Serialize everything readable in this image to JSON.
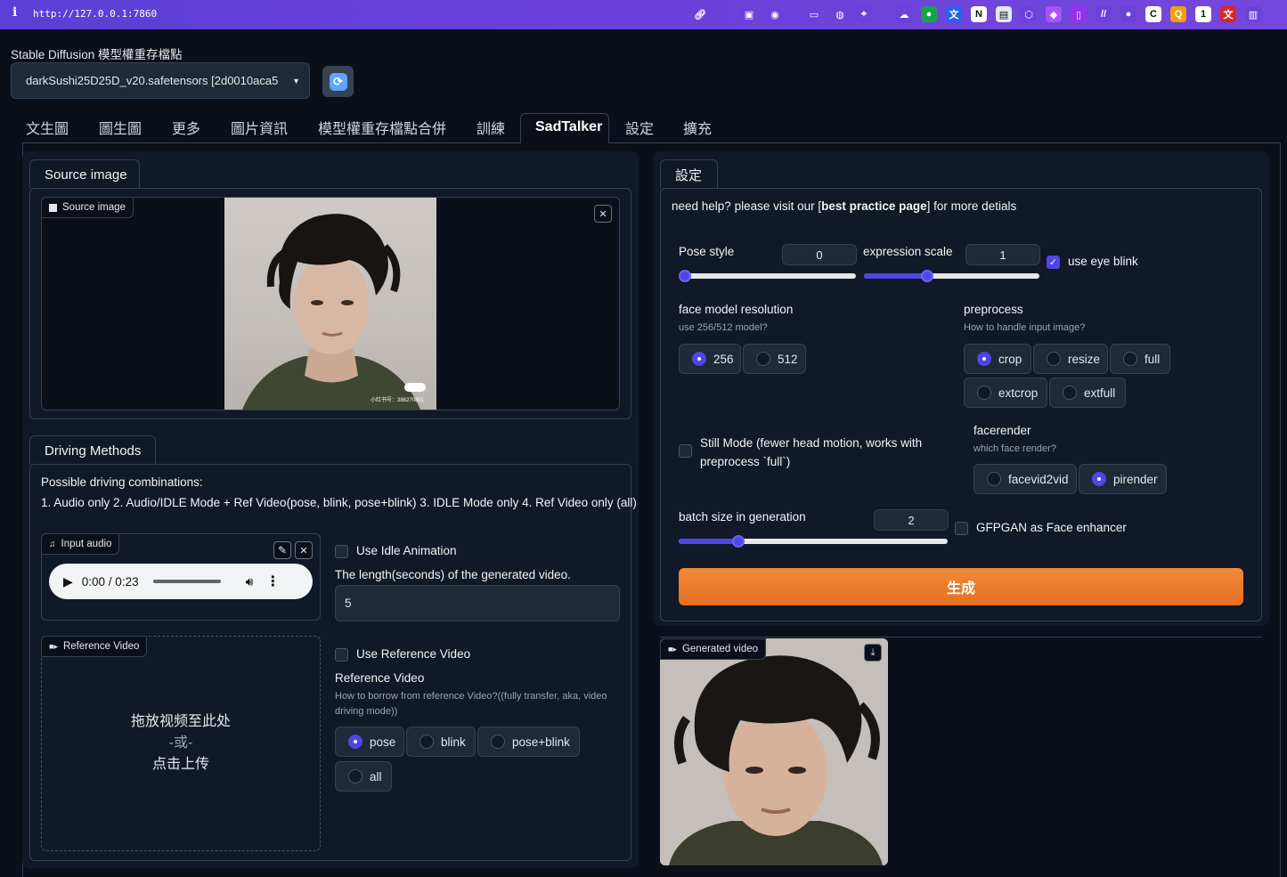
{
  "browser": {
    "info_icon": "i",
    "url": "http://127.0.0.1:7860"
  },
  "extensions": [
    "link-icon",
    "screenshot-icon",
    "camera-icon",
    "terminal-icon",
    "globe-icon",
    "target-icon",
    "cloud-icon",
    "chat-icon",
    "translate-icon",
    "N",
    "card-icon",
    "shield-icon",
    "diamond-icon",
    "bookmark-icon",
    "slash-icon",
    "dot-icon",
    "c-icon",
    "q-icon",
    "1-icon",
    "translate2-icon",
    "sidebar-icon"
  ],
  "model": {
    "label": "Stable Diffusion 模型權重存檔點",
    "selected": "darkSushi25D25D_v20.safetensors [2d0010aca5"
  },
  "tabs": [
    "文生圖",
    "圖生圖",
    "更多",
    "圖片資訊",
    "模型權重存檔點合併",
    "訓練",
    "SadTalker",
    "設定",
    "擴充"
  ],
  "active_tab": "SadTalker",
  "source": {
    "tab": "Source image",
    "label": "Source image",
    "watermark": "小红书号：386270801"
  },
  "driving": {
    "tab": "Driving Methods",
    "heading": "Possible driving combinations:",
    "combos": "1. Audio only 2. Audio/IDLE Mode + Ref Video(pose, blink, pose+blink) 3. IDLE Mode only 4. Ref Video only (all)",
    "audio_label": "Input audio",
    "audio_time": "0:00 / 0:23",
    "idle_label": "Use Idle Animation",
    "length_label": "The length(seconds) of the generated video.",
    "length_value": "5",
    "ref_label": "Reference Video",
    "drop_line1": "拖放视频至此处",
    "drop_line2": "-或-",
    "drop_line3": "点击上传",
    "use_ref_label": "Use Reference Video",
    "ref_video_title": "Reference Video",
    "ref_video_sub": "How to borrow from reference Video?((fully transfer, aka, video driving mode))",
    "ref_options": [
      "pose",
      "blink",
      "pose+blink",
      "all"
    ],
    "ref_selected": "pose"
  },
  "settings": {
    "tab": "設定",
    "help_prefix": "need help? please visit our [",
    "help_link": "best practice page",
    "help_suffix": "] for more detials",
    "pose_label": "Pose style",
    "pose_value": "0",
    "pose_fraction": 0,
    "expr_label": "expression scale",
    "expr_value": "1",
    "expr_fraction": 0.35,
    "eye_blink": "use eye blink",
    "face_res_label": "face model resolution",
    "face_res_sub": "use 256/512 model?",
    "face_res_options": [
      "256",
      "512"
    ],
    "face_res_selected": "256",
    "preprocess_label": "preprocess",
    "preprocess_sub": "How to handle input image?",
    "preprocess_options": [
      "crop",
      "resize",
      "full",
      "extcrop",
      "extfull"
    ],
    "preprocess_selected": "crop",
    "still_mode": "Still Mode (fewer head motion, works with preprocess `full`)",
    "facerender_label": "facerender",
    "facerender_sub": "which face render?",
    "facerender_options": [
      "facevid2vid",
      "pirender"
    ],
    "facerender_selected": "pirender",
    "batch_label": "batch size in generation",
    "batch_value": "2",
    "batch_fraction": 0.21,
    "gfpgan": "GFPGAN as Face enhancer",
    "generate": "生成"
  },
  "output": {
    "label": "Generated video"
  },
  "colors": {
    "accent": "#4f46e5",
    "generate": "#ea7a2a",
    "bg": "#0b0f19"
  }
}
